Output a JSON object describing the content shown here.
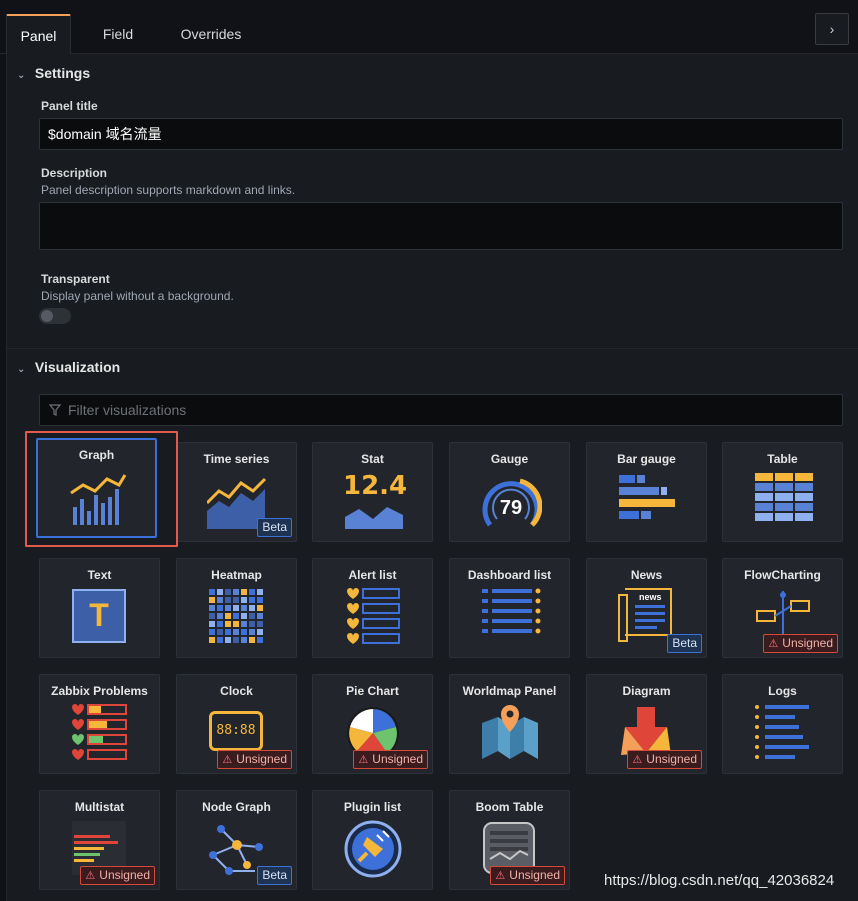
{
  "tabs": {
    "panel": "Panel",
    "field": "Field",
    "overrides": "Overrides",
    "collapse_glyph": "›"
  },
  "settings": {
    "header": "Settings",
    "panel_title_label": "Panel title",
    "panel_title_value": "$domain 域名流量",
    "description_label": "Description",
    "description_hint": "Panel description supports markdown and links.",
    "description_value": "",
    "transparent_label": "Transparent",
    "transparent_hint": "Display panel without a background.",
    "transparent_on": false
  },
  "visualization": {
    "header": "Visualization",
    "filter_placeholder": "Filter visualizations",
    "selected": "Graph",
    "cards": [
      {
        "name": "Graph",
        "icon": "graph-icon",
        "badge": ""
      },
      {
        "name": "Time series",
        "icon": "time-series-icon",
        "badge": "Beta"
      },
      {
        "name": "Stat",
        "icon": "stat-icon",
        "badge": "",
        "icon_text": "12.4"
      },
      {
        "name": "Gauge",
        "icon": "gauge-icon",
        "badge": "",
        "icon_text": "79"
      },
      {
        "name": "Bar gauge",
        "icon": "bar-gauge-icon",
        "badge": ""
      },
      {
        "name": "Table",
        "icon": "table-icon",
        "badge": ""
      },
      {
        "name": "Text",
        "icon": "text-icon",
        "badge": "",
        "icon_text": "T"
      },
      {
        "name": "Heatmap",
        "icon": "heatmap-icon",
        "badge": ""
      },
      {
        "name": "Alert list",
        "icon": "alert-list-icon",
        "badge": ""
      },
      {
        "name": "Dashboard list",
        "icon": "dashboard-list-icon",
        "badge": ""
      },
      {
        "name": "News",
        "icon": "news-icon",
        "badge": "Beta",
        "icon_text": "news"
      },
      {
        "name": "FlowCharting",
        "icon": "flowcharting-icon",
        "badge": "Unsigned"
      },
      {
        "name": "Zabbix Problems",
        "icon": "zabbix-problems-icon",
        "badge": ""
      },
      {
        "name": "Clock",
        "icon": "clock-icon",
        "badge": "Unsigned",
        "icon_text": "88:88"
      },
      {
        "name": "Pie Chart",
        "icon": "pie-chart-icon",
        "badge": "Unsigned"
      },
      {
        "name": "Worldmap Panel",
        "icon": "worldmap-icon",
        "badge": ""
      },
      {
        "name": "Diagram",
        "icon": "diagram-icon",
        "badge": "Unsigned"
      },
      {
        "name": "Logs",
        "icon": "logs-icon",
        "badge": ""
      },
      {
        "name": "Multistat",
        "icon": "multistat-icon",
        "badge": "Unsigned"
      },
      {
        "name": "Node Graph",
        "icon": "node-graph-icon",
        "badge": "Beta"
      },
      {
        "name": "Plugin list",
        "icon": "plugin-list-icon",
        "badge": ""
      },
      {
        "name": "Boom Table",
        "icon": "boom-table-icon",
        "badge": "Unsigned"
      }
    ]
  },
  "watermark": "https://blog.csdn.net/qq_42036824",
  "colors": {
    "accent_orange": "#f5a05a",
    "selected_blue": "#3871dc",
    "highlight_red": "#e05a4e",
    "icon_yellow": "#f5b73b",
    "icon_blue": "#3d71d9"
  }
}
